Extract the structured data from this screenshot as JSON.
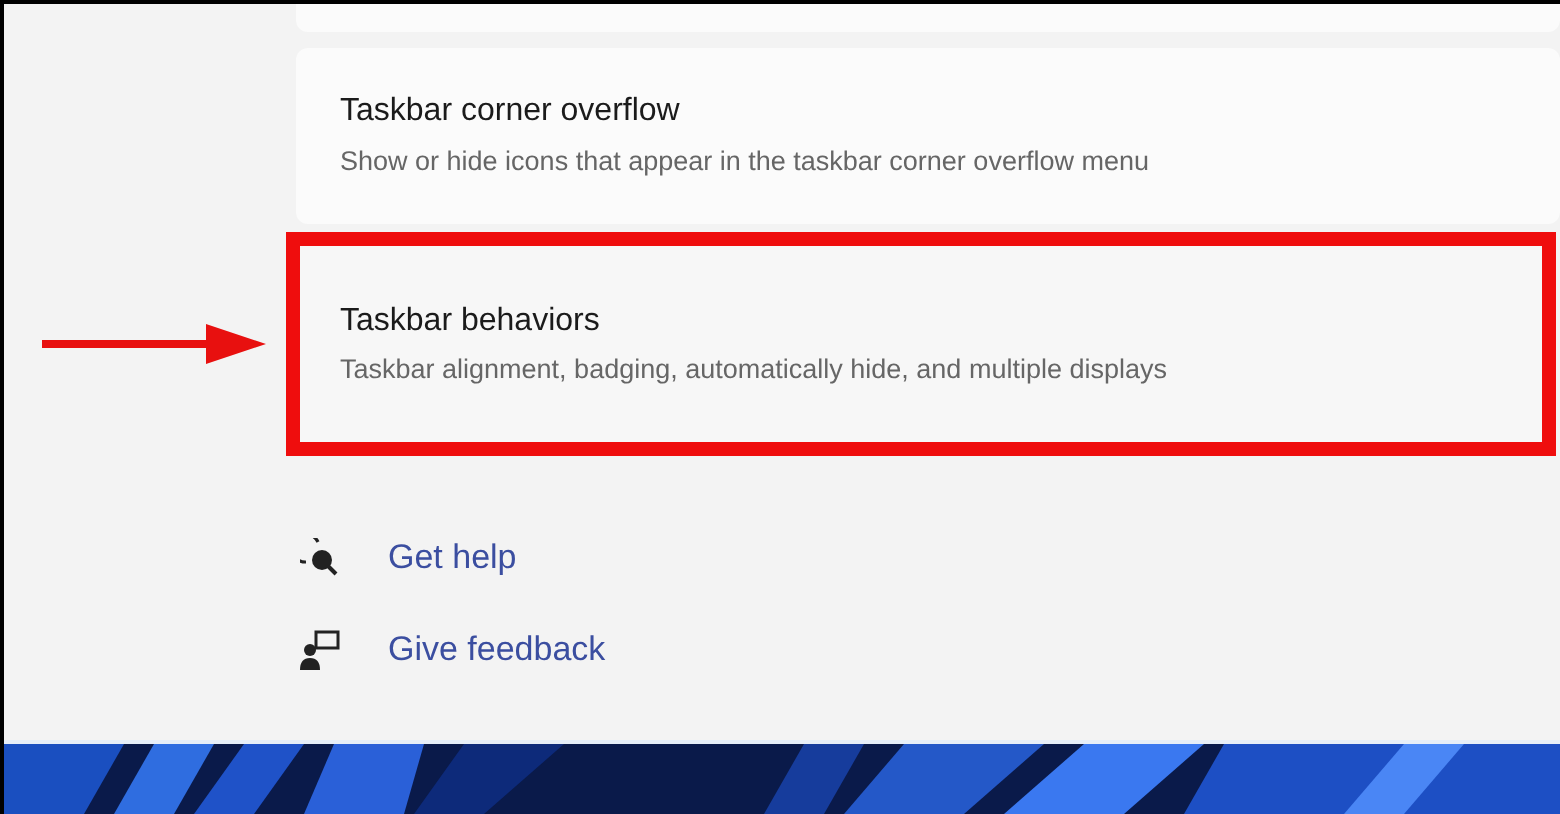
{
  "settings_items": [
    {
      "title": "Taskbar corner overflow",
      "description": "Show or hide icons that appear in the taskbar corner overflow menu",
      "highlighted": false
    },
    {
      "title": "Taskbar behaviors",
      "description": "Taskbar alignment, badging, automatically hide, and multiple displays",
      "highlighted": true
    }
  ],
  "links": [
    {
      "kind": "help",
      "label": "Get help"
    },
    {
      "kind": "feedback",
      "label": "Give feedback"
    }
  ]
}
